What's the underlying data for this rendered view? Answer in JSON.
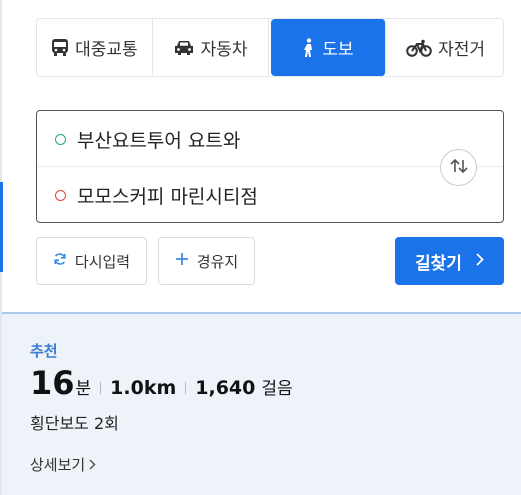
{
  "modes": [
    {
      "label": "대중교통",
      "icon": "bus-icon"
    },
    {
      "label": "자동차",
      "icon": "car-icon"
    },
    {
      "label": "도보",
      "icon": "walk-icon",
      "active": true
    },
    {
      "label": "자전거",
      "icon": "bicycle-icon"
    }
  ],
  "route": {
    "start": "부산요트투어 요트와",
    "end": "모모스커피 마린시티점"
  },
  "buttons": {
    "reset": "다시입력",
    "waypoint": "경유지",
    "search": "길찾기"
  },
  "result": {
    "recommend": "추천",
    "minutes": "16",
    "minutes_unit": "분",
    "distance": "1.0km",
    "steps": "1,640",
    "steps_unit": "걸음",
    "crossings": "횡단보도 2회",
    "details": "상세보기"
  },
  "colors": {
    "accent": "#1a73e8",
    "start_dot": "#16b06b",
    "end_dot": "#e0433a",
    "recommend": "#3a7bd5",
    "result_bg": "#edf3f9"
  }
}
